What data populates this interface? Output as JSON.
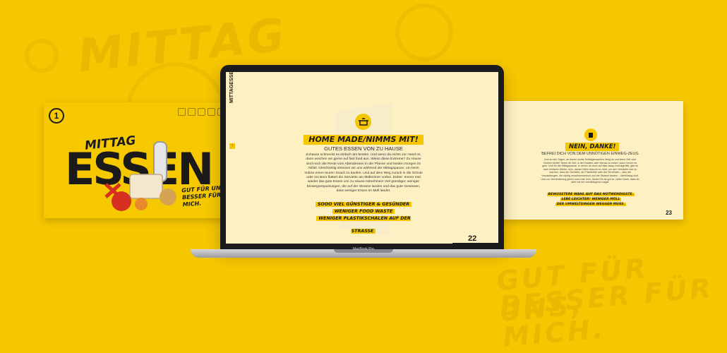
{
  "background": {
    "color": "#f6c600",
    "word_top": "MITTAG",
    "word_bottom_1": "GUT FÜR UNS,",
    "word_bottom_2": "BESSER FÜR MICH."
  },
  "left_slide": {
    "number": "1",
    "mittag": "MITTAG",
    "essen": "ESSEN",
    "slogan": "GUT FÜR UNS, BESSER FÜR MICH."
  },
  "laptop": {
    "brand": "MacBook Pro",
    "side_label": "MITTAGESSEN",
    "nav_button": "↑",
    "title": "HOME MADE/NIMMS MIT!",
    "subtitle": "GUTES ESSEN VON ZU HAUSE",
    "body": "Zuhause schmeckt es einfach am besten. Und wenn da nichts zur Hand ist, dann weichen wir gerne auf fast food aus. Wieso diese Extreme? Zu Hause sind noch die Reste vom Abendessen in der Pfanne und landen morgen im Abfall. Gleichzeitig stressen wir uns während der Mittagspause, um beim Imbiss einen teuren Snack zu kaufen. Und auf dem Weg zurück in die Schule oder ins Büro flattert die Serviette am Müllerimer vorbei. Daher: Immer mal wieder das gute Essen von zu Hause mitnehmen! Viel günstiger, weniger Einwegverpackungen, die auf der Strasse landen und das gute Gewissen, dass weniger Essen im Müll landet.",
    "highlights": [
      "SOOO VIEL GÜNSTIGER & GESÜNDER",
      "WENIGER FOOD WASTE",
      "WENIGER PLASTIKSCHALEN AUF DER STRASSE"
    ],
    "page": "22"
  },
  "right_slide": {
    "title": "NEIN, DANKE!",
    "subtitle": "BEFREI DICH VON DEM UNNÖTIGEN EINWEG-ZEUG",
    "body": "Und an den Tagen, an denen nichts Selbstgemachtes übrig ist und keine Zeit zum Kochen bleibt? Nimm dir Zeit, in der Kantine oder Mensa zu essen, wann immer es geht. Und für die Mittagspause, in denen du doch auf take-away zurückgreifst, gibt es zwei einfache Wörter, kein, danke! Mehr braucht es nicht, um den Verkäufer klar zu machen, dass die Serviette, die Plastiktüte oder der Strohhalm – also die Verpackungen, die häufig verschwenderisch auf der Strasse landen – überflüssig sind. Und zur Verminderung gleich noch mal: kein, danke! Es ist gut so, vielen Dank, dass du nicht mit mir vorwärtsgehen sagst.",
    "highlights": [
      "BEWUSSTERE WAHL AUF DAS NOTWENDIGSTE.",
      "LEBE LEICHTER! WENIGER MÜLL",
      "DER UMWELTDINGEN WEGGEN MUSS."
    ],
    "page": "23"
  }
}
